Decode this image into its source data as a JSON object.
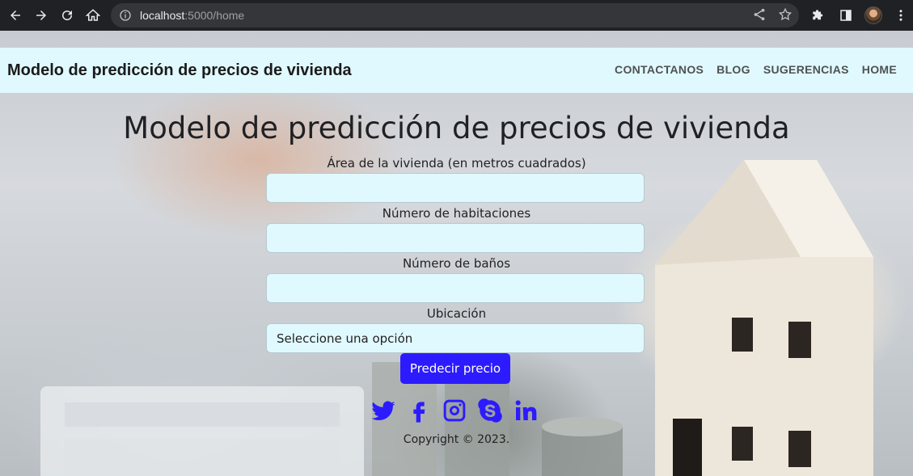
{
  "browser": {
    "url_host": "localhost",
    "url_path": ":5000/home"
  },
  "navbar": {
    "brand": "Modelo de predicción de precios de vivienda",
    "links": [
      {
        "label": "CONTACTANOS"
      },
      {
        "label": "BLOG"
      },
      {
        "label": "SUGERENCIAS"
      },
      {
        "label": "HOME"
      }
    ]
  },
  "main": {
    "title": "Modelo de predicción de precios de vivienda",
    "fields": [
      {
        "label": "Área de la vivienda (en metros cuadrados)",
        "value": ""
      },
      {
        "label": "Número de habitaciones",
        "value": ""
      },
      {
        "label": "Número de baños",
        "value": ""
      }
    ],
    "location": {
      "label": "Ubicación",
      "selected": "Seleccione una opción"
    },
    "submit_label": "Predecir precio"
  },
  "socials": [
    "twitter-icon",
    "facebook-icon",
    "instagram-icon",
    "skype-icon",
    "linkedin-icon"
  ],
  "footer": {
    "copyright": "Copyright © 2023."
  },
  "colors": {
    "accent": "#2d1bff",
    "navbar_bg": "#e0f9ff",
    "input_bg": "#e0f9ff"
  }
}
